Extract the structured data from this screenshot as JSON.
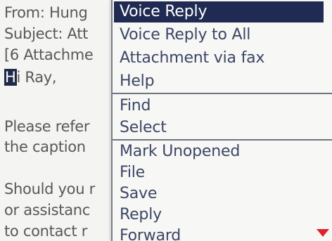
{
  "email": {
    "lines": [
      {
        "text": "From: Hung"
      },
      {
        "text": "Subject: Att"
      },
      {
        "text": "[6 Attachme"
      },
      {
        "cursor": "H",
        "text": "i Ray,"
      },
      {
        "text": ""
      },
      {
        "text": "Please refer"
      },
      {
        "text": "the caption"
      },
      {
        "text": ""
      },
      {
        "text": "Should you r"
      },
      {
        "text": "or assistanc"
      },
      {
        "text": "to contact r"
      }
    ]
  },
  "menu": {
    "items": [
      {
        "label": "Voice Reply",
        "selected": true
      },
      {
        "label": "Voice Reply to All"
      },
      {
        "label": "Attachment via fax"
      },
      {
        "label": "Help"
      },
      {
        "label": "Find"
      },
      {
        "label": "Select"
      },
      {
        "label": "Mark Unopened"
      },
      {
        "label": "File"
      },
      {
        "label": "Save"
      },
      {
        "label": "Reply"
      },
      {
        "label": "Forward"
      }
    ]
  },
  "colors": {
    "selection": "#1f2b52",
    "menu_text": "#3c4666",
    "scroll_indicator": "#e2202a"
  },
  "icons": {
    "scroll_indicator": "scroll-down-arrow-icon"
  }
}
